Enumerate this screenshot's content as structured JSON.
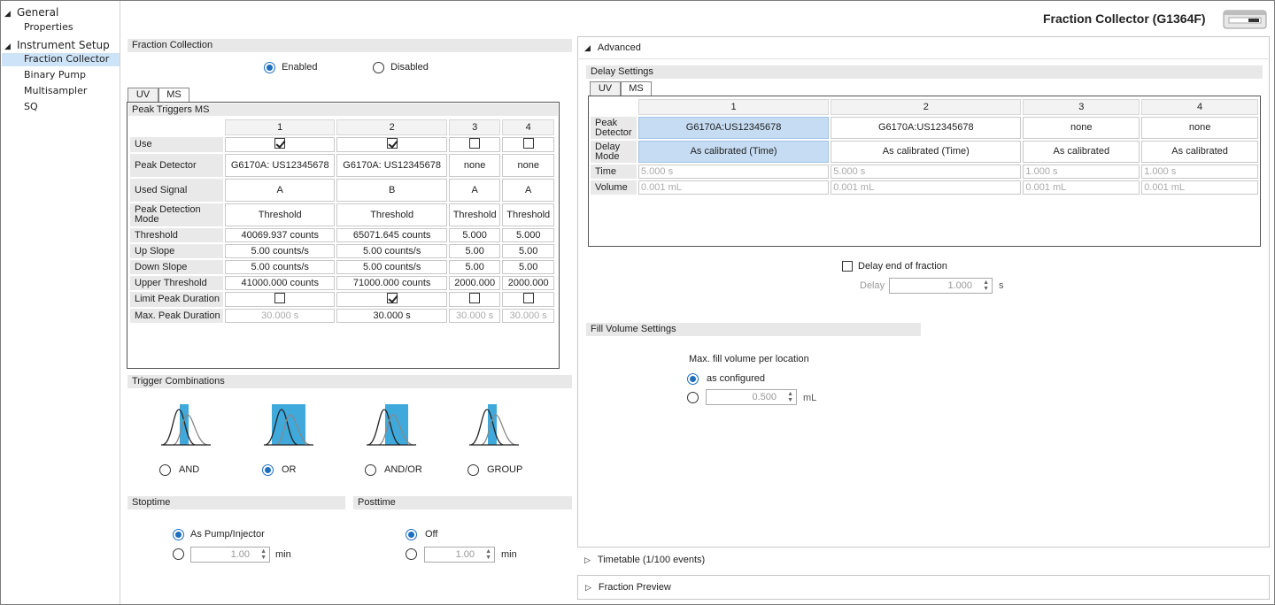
{
  "app": {
    "title": "Fraction Collector (G1364F)"
  },
  "sidebar": {
    "general": "General",
    "properties": "Properties",
    "instrument_setup": "Instrument Setup",
    "items": [
      "Fraction Collector",
      "Binary Pump",
      "Multisampler",
      "SQ"
    ]
  },
  "fraction_collection": {
    "header": "Fraction Collection",
    "enabled": "Enabled",
    "disabled": "Disabled",
    "selected": "Enabled"
  },
  "trigger_tabs": [
    "UV",
    "MS"
  ],
  "peak_triggers": {
    "title": "Peak Triggers MS",
    "columns": [
      "1",
      "2",
      "3",
      "4"
    ],
    "rows": [
      {
        "label": "Use",
        "type": "check",
        "values": [
          true,
          true,
          false,
          false
        ]
      },
      {
        "label": "Peak Detector",
        "type": "text",
        "values": [
          "G6170A: US12345678",
          "G6170A: US12345678",
          "none",
          "none"
        ]
      },
      {
        "label": "Used Signal",
        "type": "text",
        "values": [
          "A",
          "B",
          "A",
          "A"
        ]
      },
      {
        "label": "Peak Detection Mode",
        "type": "text",
        "values": [
          "Threshold",
          "Threshold",
          "Threshold",
          "Threshold"
        ]
      },
      {
        "label": "Threshold",
        "type": "text",
        "values": [
          "40069.937 counts",
          "65071.645 counts",
          "5.000",
          "5.000"
        ]
      },
      {
        "label": "Up Slope",
        "type": "text",
        "values": [
          "5.00 counts/s",
          "5.00 counts/s",
          "5.00",
          "5.00"
        ]
      },
      {
        "label": "Down Slope",
        "type": "text",
        "values": [
          "5.00 counts/s",
          "5.00 counts/s",
          "5.00",
          "5.00"
        ]
      },
      {
        "label": "Upper Threshold",
        "type": "text",
        "values": [
          "41000.000 counts",
          "71000.000 counts",
          "2000.000",
          "2000.000"
        ]
      },
      {
        "label": "Limit Peak Duration",
        "type": "check",
        "values": [
          false,
          true,
          false,
          false
        ]
      },
      {
        "label": "Max. Peak Duration",
        "type": "text",
        "values": [
          "30.000 s",
          "30.000 s",
          "30.000 s",
          "30.000 s"
        ],
        "disabled": [
          true,
          false,
          true,
          true
        ]
      }
    ]
  },
  "trigger_combinations": {
    "header": "Trigger Combinations",
    "options": [
      "AND",
      "OR",
      "AND/OR",
      "GROUP"
    ],
    "selected": "OR"
  },
  "stoptime": {
    "header": "Stoptime",
    "option1": "As Pump/Injector",
    "value": "1.00",
    "unit": "min"
  },
  "posttime": {
    "header": "Posttime",
    "option1": "Off",
    "value": "1.00",
    "unit": "min"
  },
  "advanced": {
    "label": "Advanced",
    "delay_settings": {
      "header": "Delay Settings",
      "tabs": [
        "UV",
        "MS"
      ],
      "columns": [
        "1",
        "2",
        "3",
        "4"
      ],
      "rows": [
        {
          "label": "Peak Detector",
          "values": [
            "G6170A:US12345678",
            "G6170A:US12345678",
            "none",
            "none"
          ]
        },
        {
          "label": "Delay Mode",
          "values": [
            "As calibrated (Time)",
            "As calibrated (Time)",
            "As calibrated",
            "As calibrated"
          ]
        },
        {
          "label": "Time",
          "values": [
            "5.000 s",
            "5.000 s",
            "1.000 s",
            "1.000 s"
          ]
        },
        {
          "label": "Volume",
          "values": [
            "0.001 mL",
            "0.001 mL",
            "0.001 mL",
            "0.001 mL"
          ]
        }
      ]
    },
    "delay_end": {
      "label": "Delay end of fraction",
      "delay_label": "Delay",
      "value": "1.000",
      "unit": "s"
    },
    "fill_volume": {
      "header": "Fill Volume Settings",
      "title": "Max. fill volume per location",
      "as_configured": "as configured",
      "value": "0.500",
      "unit": "mL"
    }
  },
  "timetable": {
    "label": "Timetable (1/100 events)"
  },
  "fraction_preview": {
    "label": "Fraction Preview"
  },
  "colors": {
    "accent": "#1f6fbf",
    "selection": "#c5dcf3",
    "peak_fill": "#3fa9dc"
  }
}
